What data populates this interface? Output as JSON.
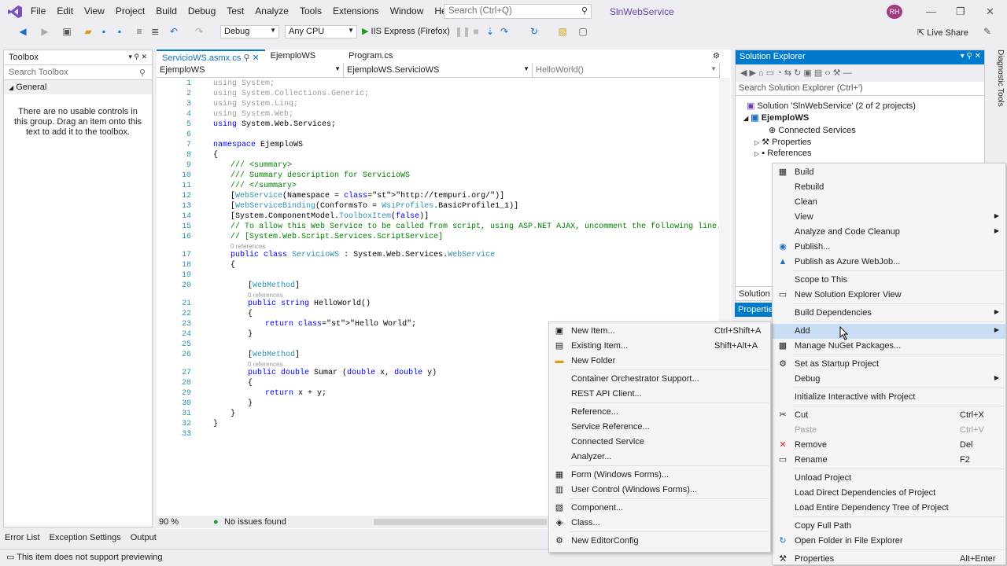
{
  "menu": {
    "items": [
      "File",
      "Edit",
      "View",
      "Project",
      "Build",
      "Debug",
      "Test",
      "Analyze",
      "Tools",
      "Extensions",
      "Window",
      "Help"
    ],
    "search_placeholder": "Search (Ctrl+Q)",
    "solution_name": "SlnWebService",
    "user_initials": "RH"
  },
  "toolbar": {
    "config": "Debug",
    "platform": "Any CPU",
    "run_target": "IIS Express (Firefox)",
    "live_share": "Live Share"
  },
  "toolbox": {
    "title": "Toolbox",
    "search_placeholder": "Search Toolbox",
    "group": "General",
    "empty_text": "There are no usable controls in this group. Drag an item onto this text to add it to the toolbox."
  },
  "editor": {
    "tabs": [
      "ServicioWS.asmx.cs",
      "EjemploWS",
      "Program.cs"
    ],
    "nav": {
      "project": "EjemploWS",
      "type": "EjemploWS.ServicioWS",
      "member": "HelloWorld()"
    },
    "zoom": "90 %",
    "issues": "No issues found",
    "lines": [
      {
        "n": "1",
        "t": "using System;",
        "cls": "gr",
        "ind": 0
      },
      {
        "n": "2",
        "t": "using System.Collections.Generic;",
        "cls": "gr",
        "ind": 0
      },
      {
        "n": "3",
        "t": "using System.Linq;",
        "cls": "gr",
        "ind": 0
      },
      {
        "n": "4",
        "t": "using System.Web;",
        "cls": "gr",
        "ind": 0
      },
      {
        "n": "5",
        "t": "using System.Web.Services;",
        "cls": "",
        "ind": 0
      },
      {
        "n": "6",
        "t": "",
        "cls": "",
        "ind": 0
      },
      {
        "n": "7",
        "t": "namespace EjemploWS",
        "cls": "",
        "ind": 0
      },
      {
        "n": "8",
        "t": "{",
        "cls": "",
        "ind": 0
      },
      {
        "n": "9",
        "t": "/// <summary>",
        "cls": "cm",
        "ind": 1
      },
      {
        "n": "10",
        "t": "/// Summary description for ServicioWS",
        "cls": "cm",
        "ind": 1
      },
      {
        "n": "11",
        "t": "/// </summary>",
        "cls": "cm",
        "ind": 1
      },
      {
        "n": "12",
        "t": "[WebService(Namespace = \"http://tempuri.org/\")]",
        "cls": "",
        "ind": 1
      },
      {
        "n": "13",
        "t": "[WebServiceBinding(ConformsTo = WsiProfiles.BasicProfile1_1)]",
        "cls": "",
        "ind": 1
      },
      {
        "n": "14",
        "t": "[System.ComponentModel.ToolboxItem(false)]",
        "cls": "",
        "ind": 1
      },
      {
        "n": "15",
        "t": "// To allow this Web Service to be called from script, using ASP.NET AJAX, uncomment the following line.",
        "cls": "cm",
        "ind": 1
      },
      {
        "n": "16",
        "t": "// [System.Web.Script.Services.ScriptService]",
        "cls": "cm",
        "ind": 1
      },
      {
        "n": "17",
        "t": "public class ServicioWS : System.Web.Services.WebService",
        "cls": "",
        "ind": 1,
        "ref": "0 references"
      },
      {
        "n": "18",
        "t": "{",
        "cls": "",
        "ind": 1
      },
      {
        "n": "19",
        "t": "",
        "cls": "",
        "ind": 0
      },
      {
        "n": "20",
        "t": "[WebMethod]",
        "cls": "",
        "ind": 2
      },
      {
        "n": "21",
        "t": "public string HelloWorld()",
        "cls": "",
        "ind": 2,
        "ref": "0 references"
      },
      {
        "n": "22",
        "t": "{",
        "cls": "",
        "ind": 2
      },
      {
        "n": "23",
        "t": "return \"Hello World\";",
        "cls": "",
        "ind": 3
      },
      {
        "n": "24",
        "t": "}",
        "cls": "",
        "ind": 2
      },
      {
        "n": "25",
        "t": "",
        "cls": "",
        "ind": 0
      },
      {
        "n": "26",
        "t": "[WebMethod]",
        "cls": "",
        "ind": 2
      },
      {
        "n": "27",
        "t": "public double Sumar (double x, double y)",
        "cls": "",
        "ind": 2,
        "ref": "0 references"
      },
      {
        "n": "28",
        "t": "{",
        "cls": "",
        "ind": 2
      },
      {
        "n": "29",
        "t": "return x + y;",
        "cls": "",
        "ind": 3
      },
      {
        "n": "30",
        "t": "}",
        "cls": "",
        "ind": 2
      },
      {
        "n": "31",
        "t": "}",
        "cls": "",
        "ind": 1
      },
      {
        "n": "32",
        "t": "}",
        "cls": "",
        "ind": 0
      },
      {
        "n": "33",
        "t": "",
        "cls": "",
        "ind": 0
      }
    ]
  },
  "solution_explorer": {
    "title": "Solution Explorer",
    "search_placeholder": "Search Solution Explorer (Ctrl+')",
    "solution": "Solution 'SlnWebService' (2 of 2 projects)",
    "project": "EjemploWS",
    "items": [
      "Connected Services",
      "Properties",
      "References"
    ],
    "bottom_tab": "Solution",
    "properties_tab": "Properties"
  },
  "bottom": {
    "tabs": [
      "Error List",
      "Exception Settings",
      "Output"
    ],
    "status": "This item does not support previewing"
  },
  "context_menu": {
    "items": [
      {
        "label": "Build",
        "icon": "build-icon"
      },
      {
        "label": "Rebuild"
      },
      {
        "label": "Clean"
      },
      {
        "label": "View",
        "sub": true
      },
      {
        "label": "Analyze and Code Cleanup",
        "sub": true
      },
      {
        "label": "Publish...",
        "icon": "globe-icon"
      },
      {
        "label": "Publish as Azure WebJob...",
        "icon": "azure-icon"
      },
      {
        "sep": true
      },
      {
        "label": "Scope to This"
      },
      {
        "label": "New Solution Explorer View",
        "icon": "window-icon"
      },
      {
        "sep": true
      },
      {
        "label": "Build Dependencies",
        "sub": true
      },
      {
        "sep": true
      },
      {
        "label": "Add",
        "sub": true,
        "hl": true
      },
      {
        "label": "Manage NuGet Packages...",
        "icon": "nuget-icon"
      },
      {
        "sep": true
      },
      {
        "label": "Set as Startup Project",
        "icon": "gear-icon"
      },
      {
        "label": "Debug",
        "sub": true
      },
      {
        "sep": true
      },
      {
        "label": "Initialize Interactive with Project"
      },
      {
        "sep": true
      },
      {
        "label": "Cut",
        "icon": "scissors-icon",
        "sc": "Ctrl+X"
      },
      {
        "label": "Paste",
        "dis": true,
        "sc": "Ctrl+V"
      },
      {
        "label": "Remove",
        "icon": "remove-icon",
        "sc": "Del"
      },
      {
        "label": "Rename",
        "icon": "rename-icon",
        "sc": "F2"
      },
      {
        "sep": true
      },
      {
        "label": "Unload Project"
      },
      {
        "label": "Load Direct Dependencies of Project"
      },
      {
        "label": "Load Entire Dependency Tree of Project"
      },
      {
        "sep": true
      },
      {
        "label": "Copy Full Path"
      },
      {
        "label": "Open Folder in File Explorer",
        "icon": "refresh-icon"
      },
      {
        "sep": true
      },
      {
        "label": "Properties",
        "icon": "wrench-icon",
        "sc": "Alt+Enter"
      }
    ]
  },
  "add_submenu": {
    "items": [
      {
        "label": "New Item...",
        "icon": "new-item-icon",
        "sc": "Ctrl+Shift+A"
      },
      {
        "label": "Existing Item...",
        "icon": "existing-item-icon",
        "sc": "Shift+Alt+A"
      },
      {
        "label": "New Folder",
        "icon": "folder-icon"
      },
      {
        "sep": true
      },
      {
        "label": "Container Orchestrator Support..."
      },
      {
        "label": "REST API Client..."
      },
      {
        "sep": true
      },
      {
        "label": "Reference..."
      },
      {
        "label": "Service Reference..."
      },
      {
        "label": "Connected Service"
      },
      {
        "label": "Analyzer..."
      },
      {
        "sep": true
      },
      {
        "label": "Form (Windows Forms)...",
        "icon": "form-icon"
      },
      {
        "label": "User Control (Windows Forms)...",
        "icon": "usercontrol-icon"
      },
      {
        "sep": true
      },
      {
        "label": "Component...",
        "icon": "component-icon"
      },
      {
        "label": "Class...",
        "icon": "class-icon"
      },
      {
        "sep": true
      },
      {
        "label": "New EditorConfig",
        "icon": "editorconfig-icon"
      }
    ]
  }
}
